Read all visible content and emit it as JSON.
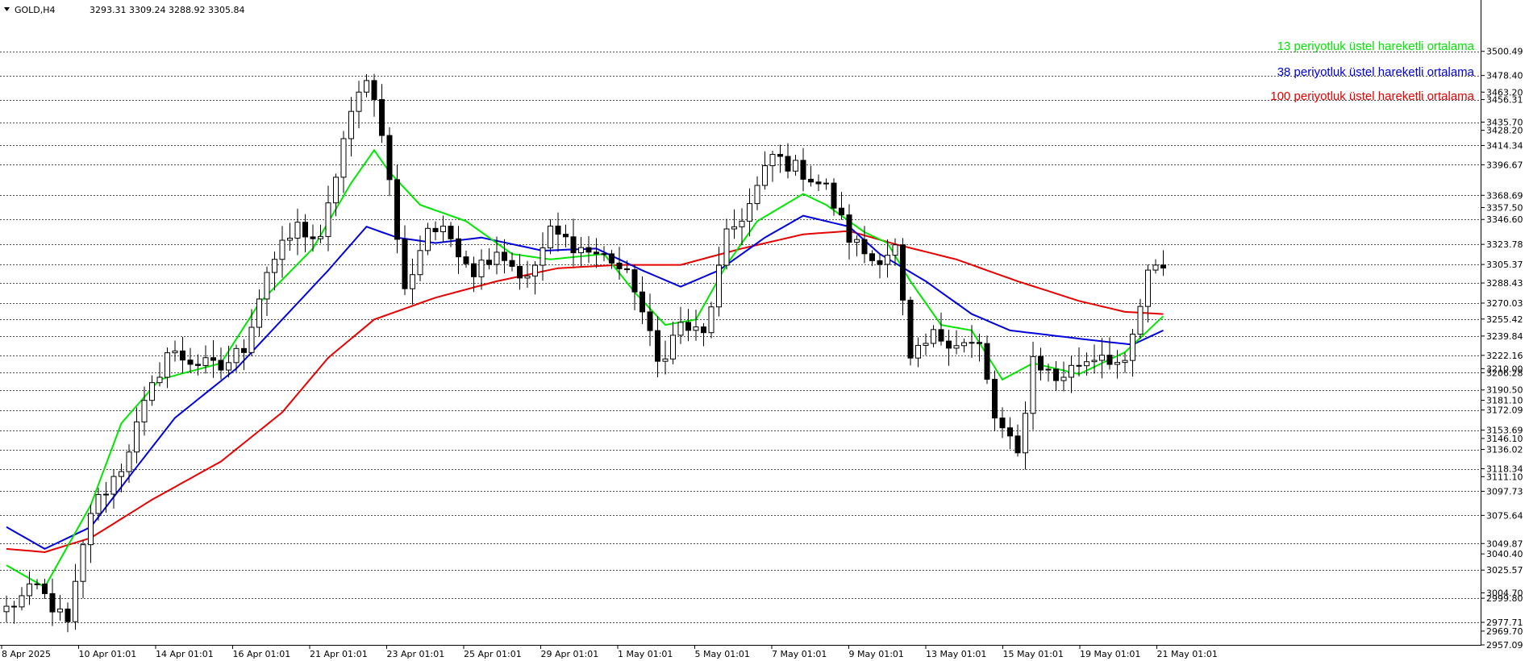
{
  "header": {
    "symbol": "GOLD,H4",
    "ohlc": "3293.31 3309.24 3288.92 3305.84"
  },
  "colors": {
    "ema13": "#00e600",
    "ema38": "#0000dd",
    "ema100": "#e60000",
    "grid": "#000000",
    "bull": "#000000",
    "bear": "#000000"
  },
  "chart_data": {
    "type": "candlestick",
    "ylim": [
      2957.09,
      3518
    ],
    "price_labels": [
      "3500.49",
      "3478.40",
      "3463.20",
      "3456.31",
      "3435.70",
      "3428.20",
      "3414.34",
      "3396.67",
      "3368.69",
      "3357.50",
      "3346.60",
      "3323.78",
      "3305.37",
      "3288.43",
      "3270.03",
      "3255.42",
      "3239.84",
      "3222.16",
      "3210.00",
      "3206.28",
      "3190.50",
      "3181.10",
      "3172.09",
      "3153.69",
      "3146.10",
      "3136.02",
      "3118.34",
      "3111.10",
      "3097.73",
      "3075.64",
      "3049.87",
      "3040.40",
      "3025.57",
      "3004.70",
      "2999.80",
      "2977.71",
      "2969.70",
      "2957.09"
    ],
    "grid_levels": [
      3500.49,
      3478.4,
      3456.31,
      3435.7,
      3414.34,
      3396.67,
      3368.69,
      3346.6,
      3323.78,
      3305.37,
      3288.43,
      3270.03,
      3255.42,
      3239.84,
      3222.16,
      3206.28,
      3190.5,
      3172.09,
      3153.69,
      3136.02,
      3118.34,
      3097.73,
      3075.64,
      3049.87,
      3025.57,
      2999.8,
      2977.71
    ],
    "x_labels": [
      "8 Apr 2025",
      "10 Apr 01:01",
      "14 Apr 01:01",
      "16 Apr 01:01",
      "21 Apr 01:01",
      "23 Apr 01:01",
      "25 Apr 01:01",
      "29 Apr 01:01",
      "1 May 01:01",
      "5 May 01:01",
      "7 May 01:01",
      "9 May 01:01",
      "13 May 01:01",
      "15 May 01:01",
      "19 May 01:01",
      "21 May 01:01"
    ],
    "legend": [
      {
        "label": "13 periyotluk üstel hareketli ortalama",
        "color": "#00e600"
      },
      {
        "label": "38 periyotluk üstel hareketli ortalama",
        "color": "#0000dd"
      },
      {
        "label": "100 periyotluk üstel hareketli ortalama",
        "color": "#e60000"
      }
    ],
    "anchors": [
      [
        0,
        2990
      ],
      [
        4,
        3010
      ],
      [
        8,
        2975
      ],
      [
        11,
        3080
      ],
      [
        15,
        3120
      ],
      [
        18,
        3175
      ],
      [
        21,
        3225
      ],
      [
        25,
        3215
      ],
      [
        28,
        3210
      ],
      [
        31,
        3230
      ],
      [
        34,
        3300
      ],
      [
        38,
        3340
      ],
      [
        41,
        3325
      ],
      [
        44,
        3420
      ],
      [
        47,
        3480
      ],
      [
        49,
        3430
      ],
      [
        52,
        3280
      ],
      [
        55,
        3340
      ],
      [
        58,
        3330
      ],
      [
        61,
        3300
      ],
      [
        64,
        3320
      ],
      [
        68,
        3290
      ],
      [
        71,
        3335
      ],
      [
        75,
        3320
      ],
      [
        79,
        3310
      ],
      [
        82,
        3285
      ],
      [
        85,
        3215
      ],
      [
        88,
        3250
      ],
      [
        91,
        3240
      ],
      [
        94,
        3330
      ],
      [
        97,
        3360
      ],
      [
        100,
        3405
      ],
      [
        104,
        3390
      ],
      [
        107,
        3375
      ],
      [
        110,
        3330
      ],
      [
        113,
        3310
      ],
      [
        116,
        3320
      ],
      [
        118,
        3215
      ],
      [
        121,
        3240
      ],
      [
        124,
        3235
      ],
      [
        127,
        3230
      ],
      [
        129,
        3165
      ],
      [
        132,
        3130
      ],
      [
        134,
        3220
      ],
      [
        137,
        3200
      ],
      [
        140,
        3215
      ],
      [
        143,
        3225
      ],
      [
        146,
        3210
      ],
      [
        149,
        3295
      ],
      [
        151,
        3305
      ]
    ],
    "ema13": [
      [
        0,
        3030
      ],
      [
        5,
        3010
      ],
      [
        11,
        3085
      ],
      [
        15,
        3160
      ],
      [
        20,
        3200
      ],
      [
        28,
        3215
      ],
      [
        33,
        3270
      ],
      [
        40,
        3320
      ],
      [
        45,
        3380
      ],
      [
        48,
        3410
      ],
      [
        50,
        3390
      ],
      [
        54,
        3360
      ],
      [
        60,
        3345
      ],
      [
        66,
        3315
      ],
      [
        71,
        3310
      ],
      [
        78,
        3315
      ],
      [
        82,
        3280
      ],
      [
        86,
        3250
      ],
      [
        90,
        3255
      ],
      [
        94,
        3305
      ],
      [
        98,
        3345
      ],
      [
        104,
        3370
      ],
      [
        107,
        3360
      ],
      [
        112,
        3335
      ],
      [
        115,
        3325
      ],
      [
        118,
        3290
      ],
      [
        122,
        3250
      ],
      [
        126,
        3245
      ],
      [
        130,
        3200
      ],
      [
        134,
        3215
      ],
      [
        140,
        3205
      ],
      [
        146,
        3225
      ],
      [
        151,
        3258
      ]
    ],
    "ema38": [
      [
        0,
        3065
      ],
      [
        5,
        3045
      ],
      [
        11,
        3065
      ],
      [
        17,
        3120
      ],
      [
        22,
        3165
      ],
      [
        30,
        3210
      ],
      [
        36,
        3255
      ],
      [
        42,
        3300
      ],
      [
        47,
        3340
      ],
      [
        51,
        3330
      ],
      [
        56,
        3325
      ],
      [
        62,
        3330
      ],
      [
        70,
        3318
      ],
      [
        77,
        3320
      ],
      [
        83,
        3300
      ],
      [
        88,
        3285
      ],
      [
        93,
        3300
      ],
      [
        99,
        3330
      ],
      [
        104,
        3350
      ],
      [
        110,
        3340
      ],
      [
        114,
        3315
      ],
      [
        120,
        3290
      ],
      [
        126,
        3260
      ],
      [
        131,
        3245
      ],
      [
        137,
        3240
      ],
      [
        143,
        3235
      ],
      [
        147,
        3232
      ],
      [
        151,
        3245
      ]
    ],
    "ema100": [
      [
        0,
        3045
      ],
      [
        5,
        3042
      ],
      [
        11,
        3055
      ],
      [
        19,
        3090
      ],
      [
        28,
        3125
      ],
      [
        36,
        3170
      ],
      [
        42,
        3220
      ],
      [
        48,
        3255
      ],
      [
        56,
        3275
      ],
      [
        64,
        3290
      ],
      [
        72,
        3302
      ],
      [
        80,
        3305
      ],
      [
        88,
        3305
      ],
      [
        96,
        3320
      ],
      [
        104,
        3333
      ],
      [
        110,
        3336
      ],
      [
        116,
        3324
      ],
      [
        124,
        3310
      ],
      [
        132,
        3290
      ],
      [
        140,
        3272
      ],
      [
        146,
        3262
      ],
      [
        151,
        3260
      ]
    ]
  }
}
